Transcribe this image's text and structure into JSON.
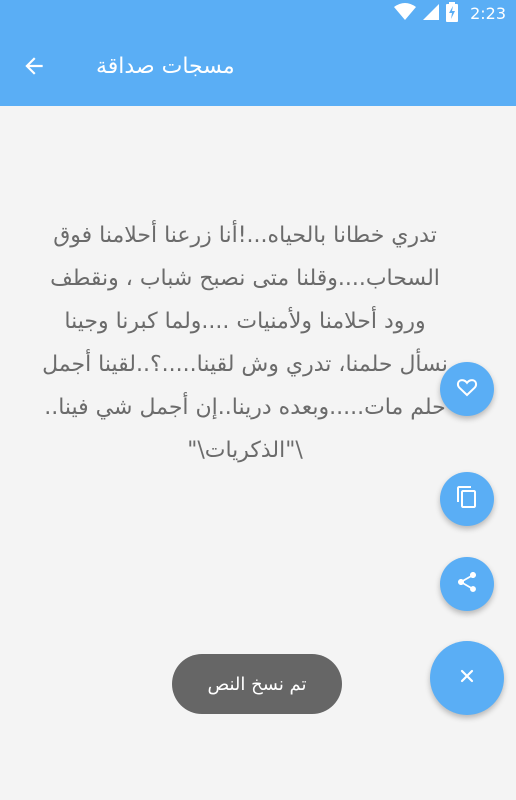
{
  "status_bar": {
    "time": "2:23",
    "icons": [
      "wifi-icon",
      "cell-signal-icon",
      "battery-charging-icon"
    ]
  },
  "app_bar": {
    "title": "مسجات صداقة",
    "back_icon": "arrow-back-icon"
  },
  "message": {
    "text": "تدري خطانا بالحياه...!أنا زرعنا أحلامنا فوق\nالسحاب....وقلنا متى نصبح شباب ، ونقطف\nورود أحلامنا ولأمنيات ....ولما كبرنا وجينا\nنسأل حلمنا، تدري وش لقينا.....؟..لقينا أجمل\nحلم مات.....وبعده درينا..إن أجمل شي فينا..\n\\\"الذكريات\\\""
  },
  "actions": {
    "favorite_icon": "heart-icon",
    "copy_icon": "copy-icon",
    "share_icon": "share-icon",
    "close_icon": "close-icon"
  },
  "toast": {
    "text": "تم نسخ النص"
  },
  "colors": {
    "primary": "#5aaef5",
    "background": "#f4f4f4",
    "text": "#6b6b6b",
    "toast_bg": "#666666"
  }
}
